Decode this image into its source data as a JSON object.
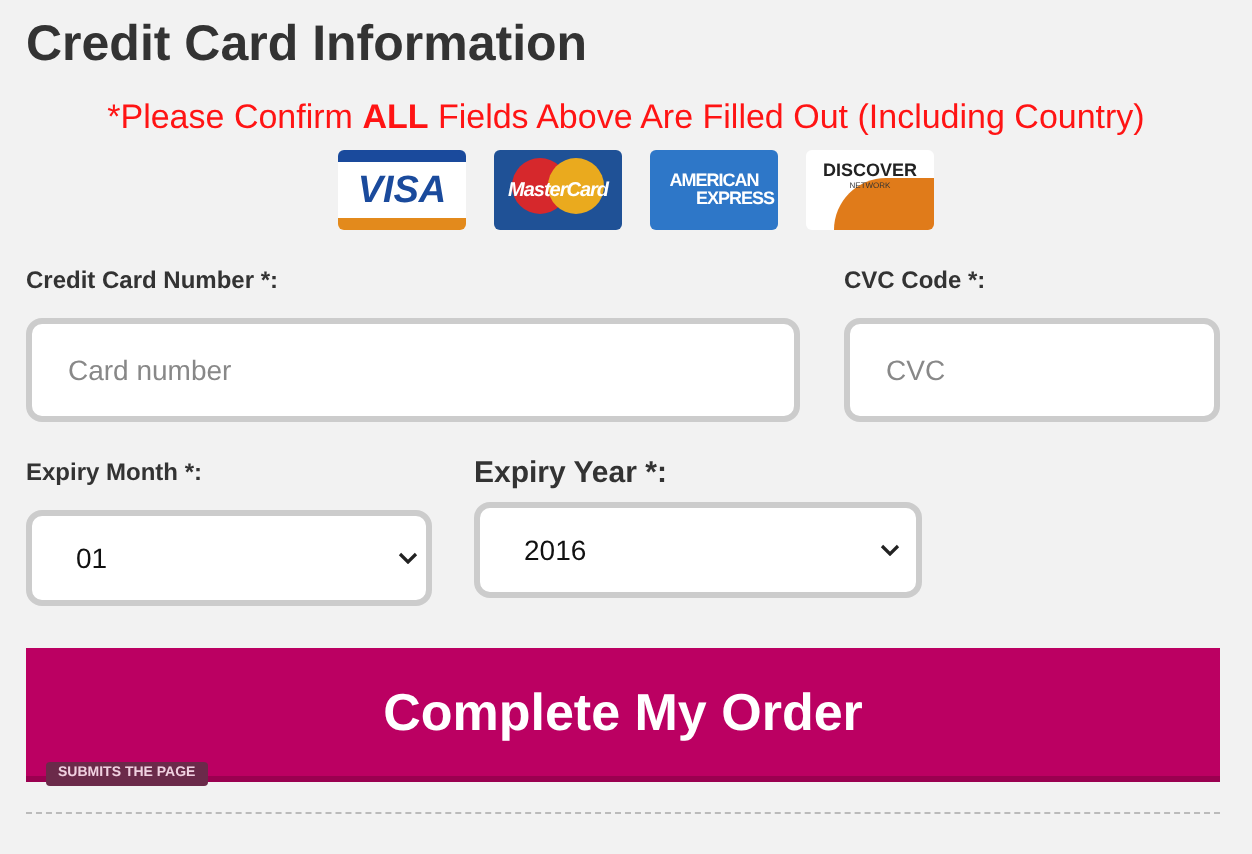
{
  "title": "Credit Card Information",
  "notice": "*Please Confirm **ALL** Fields Above Are Filled Out (Including Country)",
  "cards": [
    {
      "kind": "visa",
      "label": "VISA"
    },
    {
      "kind": "mastercard",
      "label": "MasterCard"
    },
    {
      "kind": "amex",
      "label": "AMERICAN",
      "label2": "EXPRESS"
    },
    {
      "kind": "discover",
      "label": "DISCOVER",
      "label2": "NETWORK"
    }
  ],
  "card_number": {
    "label": "Credit Card Number *:",
    "placeholder": "Card number"
  },
  "cvc": {
    "label": "CVC Code *:",
    "placeholder": "CVC"
  },
  "expiry_month": {
    "label": "Expiry Month *:",
    "value": "01"
  },
  "expiry_year": {
    "label": "Expiry Year *:",
    "value": "2016"
  },
  "submit": {
    "label": "Complete My Order",
    "badge": "SUBMITS THE PAGE"
  }
}
